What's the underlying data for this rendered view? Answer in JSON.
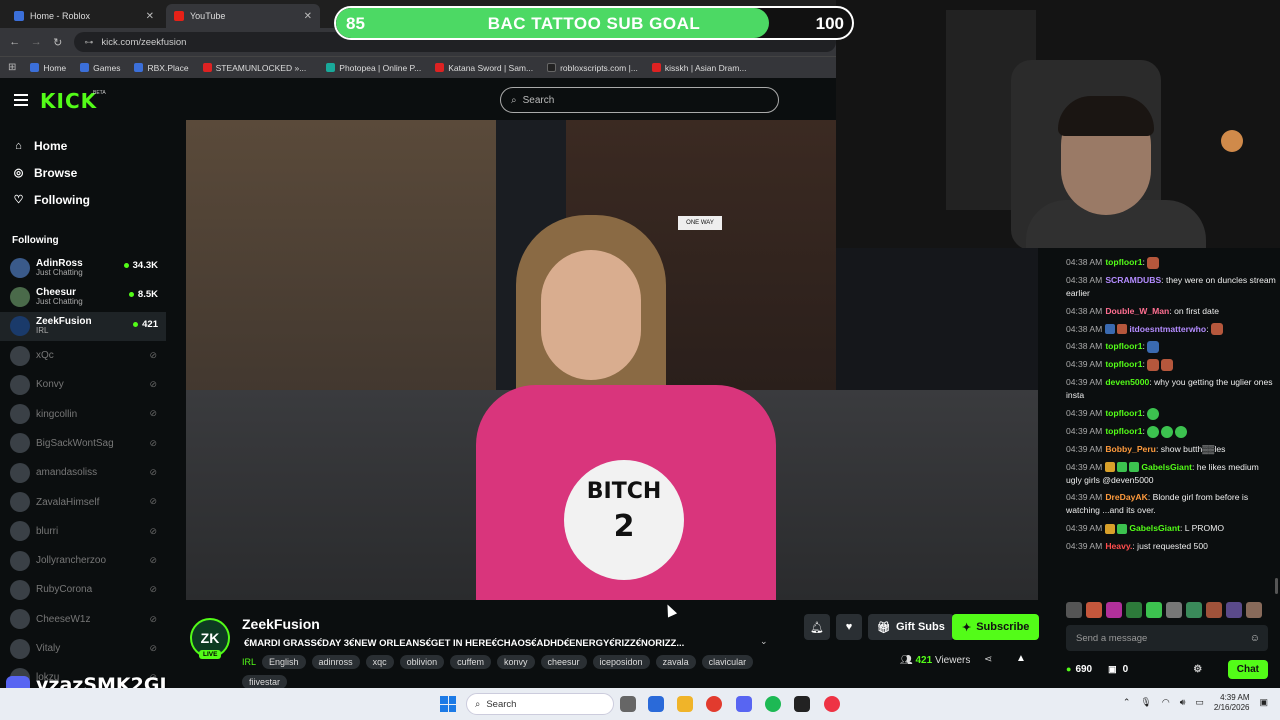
{
  "browser": {
    "tabs": [
      {
        "title": "Home - Roblox",
        "color": "#3b6fd9"
      },
      {
        "title": "YouTube",
        "color": "#e62117"
      }
    ],
    "url": "kick.com/zeekfusion",
    "bookmarks": [
      {
        "label": "Home",
        "color": "#3b6fd9"
      },
      {
        "label": "Games",
        "color": "#3b6fd9"
      },
      {
        "label": "RBX.Place",
        "color": "#3b6fd9"
      },
      {
        "label": "STEAMUNLOCKED »...",
        "color": "#d22"
      },
      {
        "label": "Photopea | Online P...",
        "color": "#19a99a"
      },
      {
        "label": "Katana Sword | Sam...",
        "color": "#d22"
      },
      {
        "label": "robloxscripts.com |...",
        "color": "#222"
      },
      {
        "label": "kisskh | Asian Dram...",
        "color": "#d22"
      }
    ]
  },
  "goal": {
    "current": "85",
    "target": "100",
    "title": "BAC TATTOO SUB GOAL",
    "progress": 0.84,
    "fill_color": "#4cd964"
  },
  "kick": {
    "logo": "KICK",
    "beta": "BETA",
    "search_placeholder": "Search"
  },
  "sidebar": {
    "nav": [
      {
        "label": "Home",
        "icon": "home-icon"
      },
      {
        "label": "Browse",
        "icon": "compass-icon"
      },
      {
        "label": "Following",
        "icon": "heart-icon"
      }
    ],
    "following_title": "Following",
    "following": [
      {
        "name": "AdinRoss",
        "category": "Just Chatting",
        "viewers": "34.3K",
        "live": true
      },
      {
        "name": "Cheesur",
        "category": "Just Chatting",
        "viewers": "8.5K",
        "live": true
      },
      {
        "name": "ZeekFusion",
        "category": "IRL",
        "viewers": "421",
        "live": true,
        "active": true
      },
      {
        "name": "xQc",
        "live": false
      },
      {
        "name": "Konvy",
        "live": false
      },
      {
        "name": "kingcollin",
        "live": false
      },
      {
        "name": "BigSackWontSag",
        "live": false
      },
      {
        "name": "amandasoliss",
        "live": false
      },
      {
        "name": "ZavalaHimself",
        "live": false
      },
      {
        "name": "blurri",
        "live": false
      },
      {
        "name": "Jollyrancherzoo",
        "live": false
      },
      {
        "name": "RubyCorona",
        "live": false
      },
      {
        "name": "CheeseW1z",
        "live": false
      },
      {
        "name": "Vitaly",
        "live": false
      },
      {
        "name": "lokzu",
        "live": false
      }
    ]
  },
  "video": {
    "sign": "ONE WAY",
    "shirt_text_1": "BITCH",
    "shirt_text_2": "2"
  },
  "chat": {
    "messages": [
      {
        "time": "04:38 AM",
        "user": "topfloor1",
        "color": "#53fc18",
        "text": "",
        "emotes": [
          "r"
        ]
      },
      {
        "time": "04:38 AM",
        "user": "SCRAMDUBS",
        "color": "#b48cff",
        "text": "they were on duncles stream earlier"
      },
      {
        "time": "04:38 AM",
        "user": "Double_W_Man",
        "color": "#ff6f91",
        "text": "on first date"
      },
      {
        "time": "04:38 AM",
        "user": "itdoesntmatterwho",
        "color": "#b48cff",
        "text": "",
        "badges": [
          "b",
          "r"
        ],
        "emotes": [
          "r"
        ]
      },
      {
        "time": "04:38 AM",
        "user": "topfloor1",
        "color": "#53fc18",
        "text": "",
        "emotes": [
          "b"
        ]
      },
      {
        "time": "04:39 AM",
        "user": "topfloor1",
        "color": "#53fc18",
        "text": "",
        "emotes": [
          "r",
          "r"
        ]
      },
      {
        "time": "04:39 AM",
        "user": "deven5000",
        "color": "#53fc18",
        "text": "why you getting the uglier ones insta"
      },
      {
        "time": "04:39 AM",
        "user": "topfloor1",
        "color": "#53fc18",
        "text": "",
        "emotes": [
          "g"
        ]
      },
      {
        "time": "04:39 AM",
        "user": "topfloor1",
        "color": "#53fc18",
        "text": "",
        "emotes": [
          "g",
          "g",
          "g"
        ]
      },
      {
        "time": "04:39 AM",
        "user": "Bobby_Peru",
        "color": "#ff9b3d",
        "text": "show butth▒▒les"
      },
      {
        "time": "04:39 AM",
        "user": "GabelsGiant",
        "color": "#53fc18",
        "text": "he likes medium ugly girls @deven5000",
        "badges": [
          "y",
          "g",
          "g"
        ]
      },
      {
        "time": "04:39 AM",
        "user": "DreDayAK",
        "color": "#ff9b3d",
        "text": "Blonde girl from before is watching ...and its over."
      },
      {
        "time": "04:39 AM",
        "user": "GabelsGiant",
        "color": "#53fc18",
        "text": "L PROMO",
        "badges": [
          "y",
          "g"
        ]
      },
      {
        "time": "04:39 AM",
        "user": "Heavy.",
        "color": "#ff4d4d",
        "text": "just requested 500"
      }
    ],
    "input_placeholder": "Send a message",
    "points": "690",
    "store_count": "0",
    "chat_button": "Chat"
  },
  "stream": {
    "name": "ZeekFusion",
    "avatar_initials": "ZK",
    "live_badge": "LIVE",
    "title": "€́MARDI GRASS€́DAY 3€́NEW ORLEANS€́GET IN HERE€́CHAOS€́ADHD€́ENERGY€́RIZZ€́NORIZZ...",
    "category": "IRL",
    "tags": [
      "English",
      "adinross",
      "xqc",
      "oblivion",
      "cuffem",
      "konvy",
      "cheesur",
      "iceposidon",
      "zavala",
      "clavicular",
      "fiivestar"
    ],
    "gift_label": "Gift Subs",
    "subscribe_label": "Subscribe",
    "viewers_count": "421",
    "viewers_label": "Viewers"
  },
  "overlay": {
    "discord_handle": "vzazSMK2GJ"
  },
  "taskbar": {
    "search_placeholder": "Search",
    "time": "4:39 AM",
    "date": "2/16/2026"
  }
}
